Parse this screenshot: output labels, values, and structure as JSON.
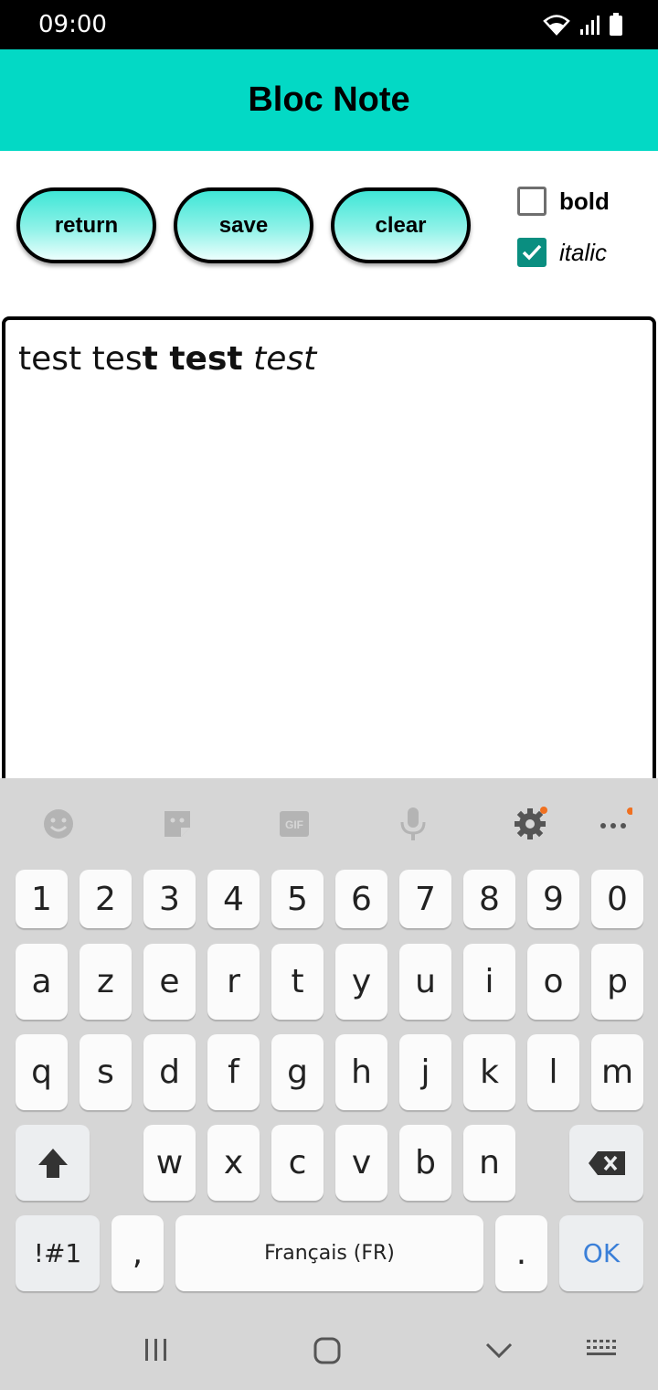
{
  "status_bar": {
    "time": "09:00"
  },
  "app_bar": {
    "title": "Bloc Note"
  },
  "toolbar": {
    "return_label": "return",
    "save_label": "save",
    "clear_label": "clear"
  },
  "options": {
    "bold": {
      "label": "bold",
      "checked": false
    },
    "italic": {
      "label": "italic",
      "checked": true
    }
  },
  "editor": {
    "segments": [
      {
        "text": "test tes",
        "style": "normal"
      },
      {
        "text": "t test",
        "style": "bold"
      },
      {
        "text": " ",
        "style": "normal"
      },
      {
        "text": "test",
        "style": "italic"
      }
    ]
  },
  "keyboard": {
    "toolbar_icons": [
      "emoji-icon",
      "sticker-icon",
      "gif-icon",
      "microphone-icon",
      "settings-icon",
      "more-icon"
    ],
    "gif_label": "GIF",
    "row_numbers": [
      "1",
      "2",
      "3",
      "4",
      "5",
      "6",
      "7",
      "8",
      "9",
      "0"
    ],
    "row1": [
      "a",
      "z",
      "e",
      "r",
      "t",
      "y",
      "u",
      "i",
      "o",
      "p"
    ],
    "row2": [
      "q",
      "s",
      "d",
      "f",
      "g",
      "h",
      "j",
      "k",
      "l",
      "m"
    ],
    "row3": [
      "w",
      "x",
      "c",
      "v",
      "b",
      "n"
    ],
    "symbols_label": "!#1",
    "comma_label": ",",
    "space_label": "Français (FR)",
    "period_label": ".",
    "ok_label": "OK"
  },
  "colors": {
    "app_bar": "#03D9C5",
    "checkbox_checked": "#0A8E80",
    "ok_key": "#3A7FD8"
  }
}
